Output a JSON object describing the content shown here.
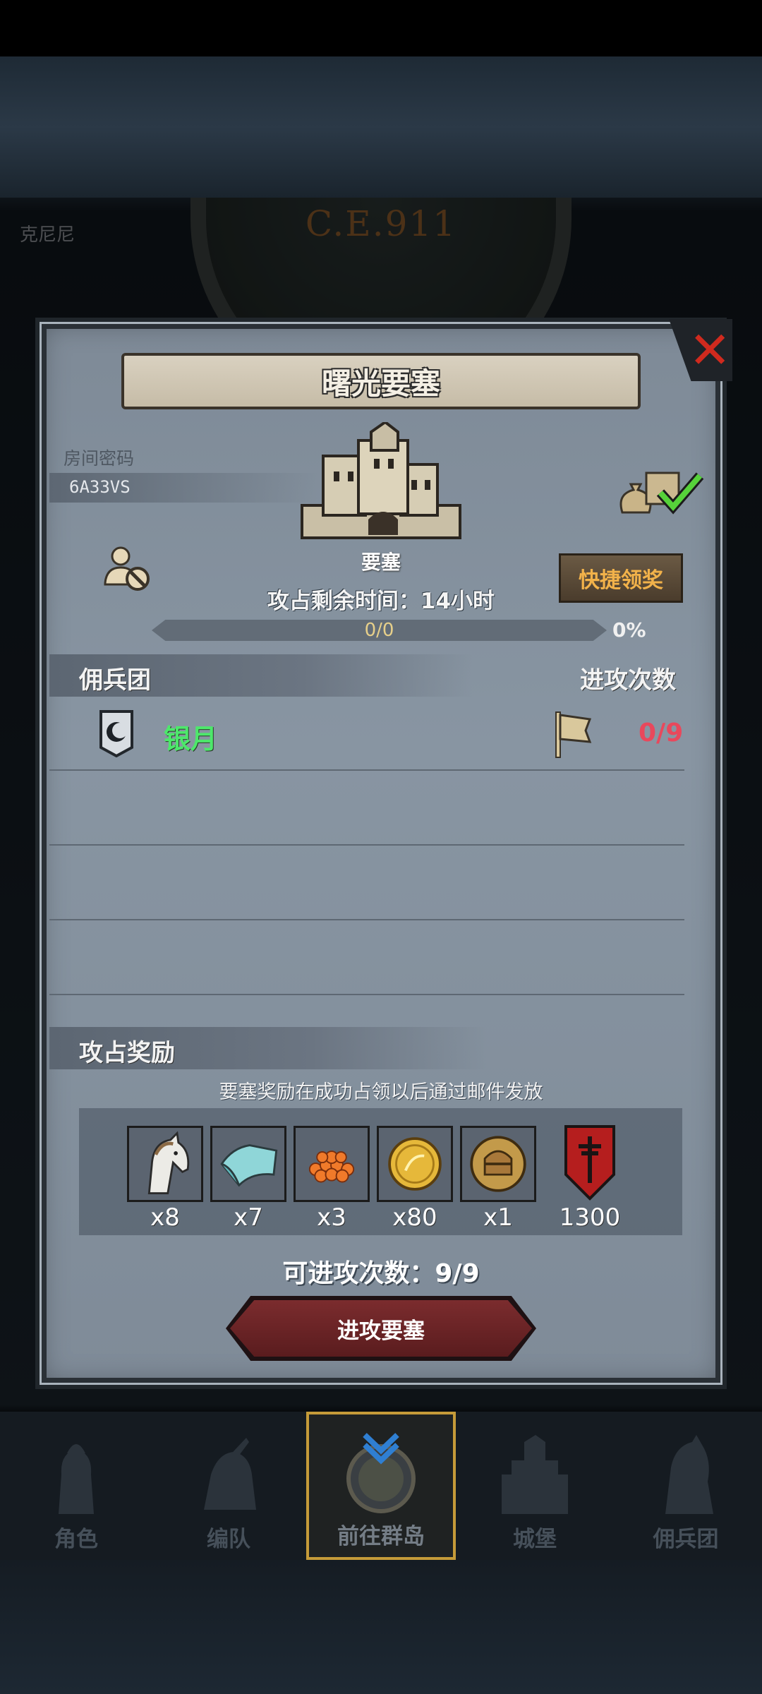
{
  "background": {
    "era": "C.E.911",
    "top_left_label": "克尼尼"
  },
  "dialog": {
    "title": "曙光要塞",
    "room_label": "房间密码",
    "room_code": "6A33VS",
    "castle_name": "要塞",
    "time_remaining": "攻占剩余时间：14小时",
    "progress_text": "0/0",
    "progress_fraction": 0,
    "progress_percent": "0%",
    "quick_claim_label": "快捷领奖",
    "mercenary_header": "佣兵团",
    "attacks_header": "进攻次数",
    "mercenary_rows": [
      {
        "name": "银月",
        "attacks": "0/9"
      }
    ],
    "reward_header": "攻占奖励",
    "reward_note": "要塞奖励在成功占领以后通过邮件发放",
    "rewards": [
      {
        "icon": "horse-icon",
        "qty": "x8"
      },
      {
        "icon": "cloth-icon",
        "qty": "x7"
      },
      {
        "icon": "caviar-icon",
        "qty": "x3"
      },
      {
        "icon": "gold-coin-icon",
        "qty": "x80"
      },
      {
        "icon": "knight-medal-icon",
        "qty": "x1"
      },
      {
        "icon": "banner-icon",
        "qty": "1300"
      }
    ],
    "can_attack": "可进攻次数：9/9",
    "attack_button": "进攻要塞"
  },
  "bottom_nav": [
    {
      "label": "角色",
      "icon": "character-icon",
      "active": false
    },
    {
      "label": "编队",
      "icon": "formation-icon",
      "active": false
    },
    {
      "label": "前往群岛",
      "icon": "islands-icon",
      "active": true
    },
    {
      "label": "城堡",
      "icon": "castle-icon",
      "active": false
    },
    {
      "label": "佣兵团",
      "icon": "mercenary-icon",
      "active": false
    }
  ],
  "colors": {
    "panel": "#8591a0",
    "merc_name": "#4de86b",
    "attacks": "#e9485c",
    "quick_claim_text": "#f2b24a",
    "attack_button": "#6b2427",
    "nav_active_border": "#c59b39"
  }
}
